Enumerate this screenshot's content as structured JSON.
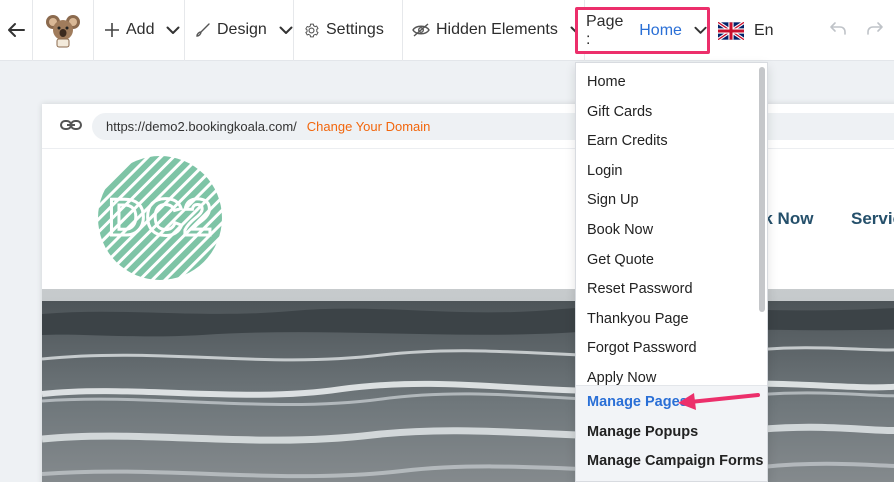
{
  "toolbar": {
    "add_label": "Add",
    "design_label": "Design",
    "settings_label": "Settings",
    "hidden_label": "Hidden Elements",
    "page_label": "Page :",
    "page_value": "Home",
    "lang_label": "En",
    "accent_color": "#ec2f6b",
    "value_color": "#2a6fd6"
  },
  "urlbar": {
    "url": "https://demo2.bookingkoala.com/",
    "change_label": "Change Your Domain"
  },
  "site": {
    "logo_text": "DC2",
    "nav_book": "ok Now",
    "nav_services": "Servic"
  },
  "dropdown": {
    "pages": [
      "Home",
      "Gift Cards",
      "Earn Credits",
      "Login",
      "Sign Up",
      "Book Now",
      "Get Quote",
      "Reset Password",
      "Thankyou Page",
      "Forgot Password",
      "Apply Now"
    ],
    "manage_pages": "Manage Pages",
    "manage_popups": "Manage Popups",
    "manage_campaign": "Manage Campaign Forms"
  }
}
